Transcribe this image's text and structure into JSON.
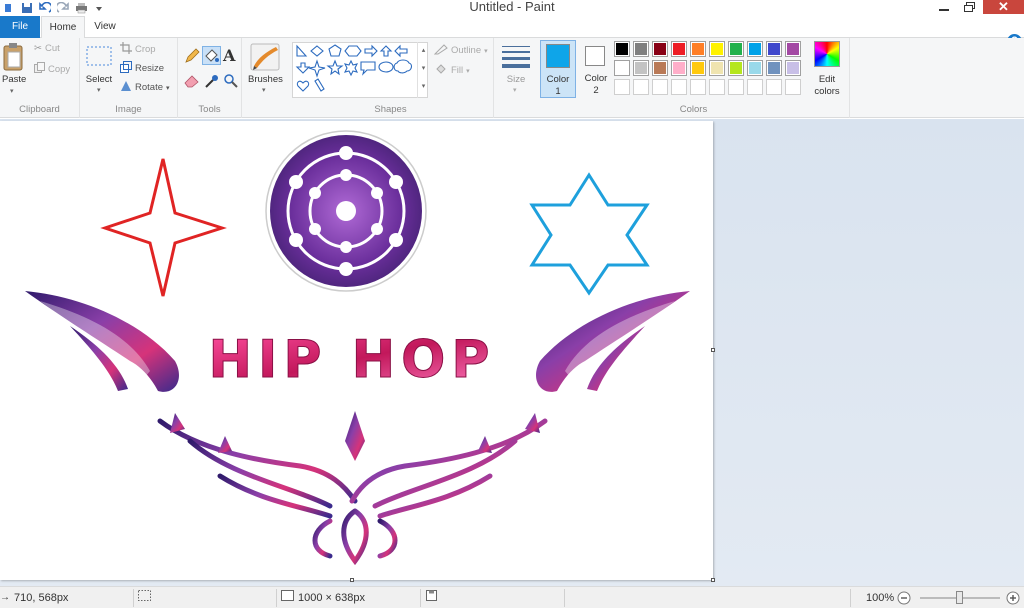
{
  "window": {
    "title": "Untitled - Paint"
  },
  "tabs": {
    "file": "File",
    "home": "Home",
    "view": "View"
  },
  "clipboard": {
    "paste": "Paste",
    "cut": "Cut",
    "copy": "Copy",
    "label": "Clipboard"
  },
  "image": {
    "select": "Select",
    "crop": "Crop",
    "resize": "Resize",
    "rotate": "Rotate",
    "label": "Image"
  },
  "tools": {
    "label": "Tools",
    "text_glyph": "A"
  },
  "brushes": {
    "label": "Brushes"
  },
  "shapes": {
    "outline": "Outline",
    "fill": "Fill",
    "label": "Shapes"
  },
  "size": {
    "label": "Size"
  },
  "colors": {
    "color1": "Color",
    "color1_num": "1",
    "color2": "Color",
    "color2_num": "2",
    "edit": "Edit",
    "edit2": "colors",
    "label": "Colors",
    "active_color1": "#0ea5e9",
    "palette_row1": [
      "#000000",
      "#7f7f7f",
      "#880015",
      "#ed1c24",
      "#ff7f27",
      "#fff200",
      "#22b14c",
      "#00a2e8",
      "#3f48cc",
      "#a349a4"
    ],
    "palette_row2": [
      "#ffffff",
      "#c3c3c3",
      "#b97a57",
      "#ffaec9",
      "#ffc90e",
      "#efe4b0",
      "#b5e61d",
      "#99d9ea",
      "#7092be",
      "#c8bfe7"
    ]
  },
  "canvas": {
    "text": "HIP HOP",
    "accent_red": "#e02424",
    "accent_blue": "#1ea0dc",
    "galaxy_purple": "#5b2a86",
    "galaxy_pink": "#d6336c"
  },
  "status": {
    "cursor": "710, 568px",
    "size": "1000 × 638px",
    "zoom": "100%"
  }
}
